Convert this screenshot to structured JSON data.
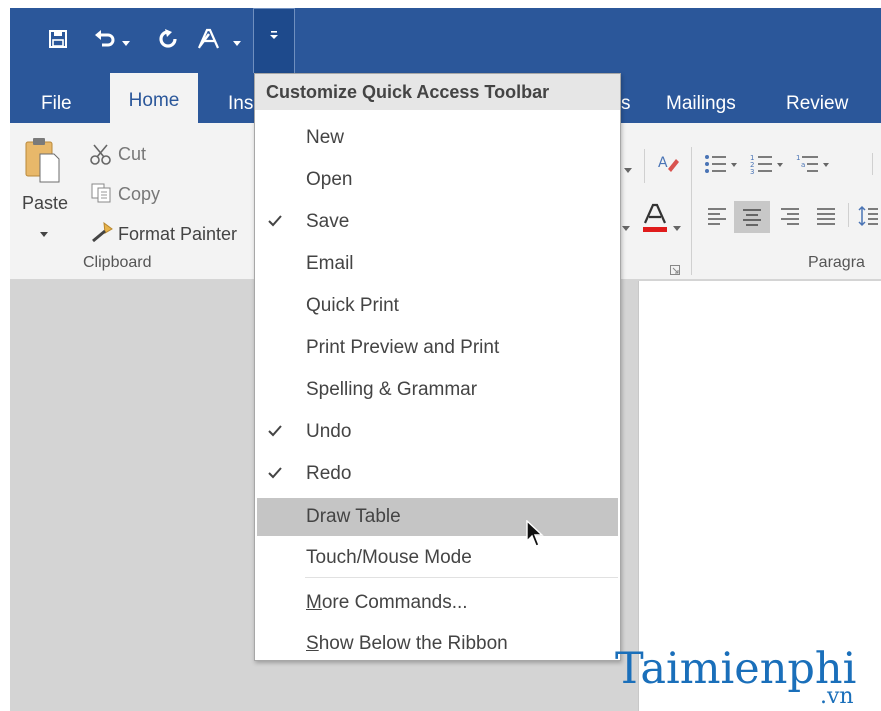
{
  "qat": {
    "customize_title": "Customize Quick Access Toolbar"
  },
  "tabs": [
    {
      "label": "File"
    },
    {
      "label": "Home"
    },
    {
      "label": "Ins"
    },
    {
      "label": "s"
    },
    {
      "label": "Mailings"
    },
    {
      "label": "Review"
    }
  ],
  "ribbon": {
    "clipboard": {
      "paste": "Paste",
      "cut": "Cut",
      "copy": "Copy",
      "format_painter": "Format Painter",
      "group_label": "Clipboard"
    },
    "paragraph": {
      "group_label": "Paragra"
    }
  },
  "menu": {
    "header": "Customize Quick Access Toolbar",
    "items": [
      {
        "label": "New",
        "checked": false
      },
      {
        "label": "Open",
        "checked": false
      },
      {
        "label": "Save",
        "checked": true
      },
      {
        "label": "Email",
        "checked": false
      },
      {
        "label": "Quick Print",
        "checked": false
      },
      {
        "label": "Print Preview and Print",
        "checked": false
      },
      {
        "label": "Spelling & Grammar",
        "checked": false
      },
      {
        "label": "Undo",
        "checked": true
      },
      {
        "label": "Redo",
        "checked": true
      },
      {
        "label": "Draw Table",
        "checked": false,
        "highlighted": true
      },
      {
        "label": "Touch/Mouse Mode",
        "checked": false
      }
    ],
    "more_commands": {
      "accel": "M",
      "rest": "ore Commands..."
    },
    "show_below": {
      "accel": "S",
      "rest": "how Below the Ribbon"
    }
  },
  "watermark": {
    "brand_a": "T",
    "brand_b": "aimienphi",
    "suffix": ".vn"
  },
  "colors": {
    "brand_blue": "#2b579a",
    "ribbon_bg": "#f3f3f3",
    "highlight": "#c5c5c5",
    "font_color_red": "#e01b1b"
  }
}
